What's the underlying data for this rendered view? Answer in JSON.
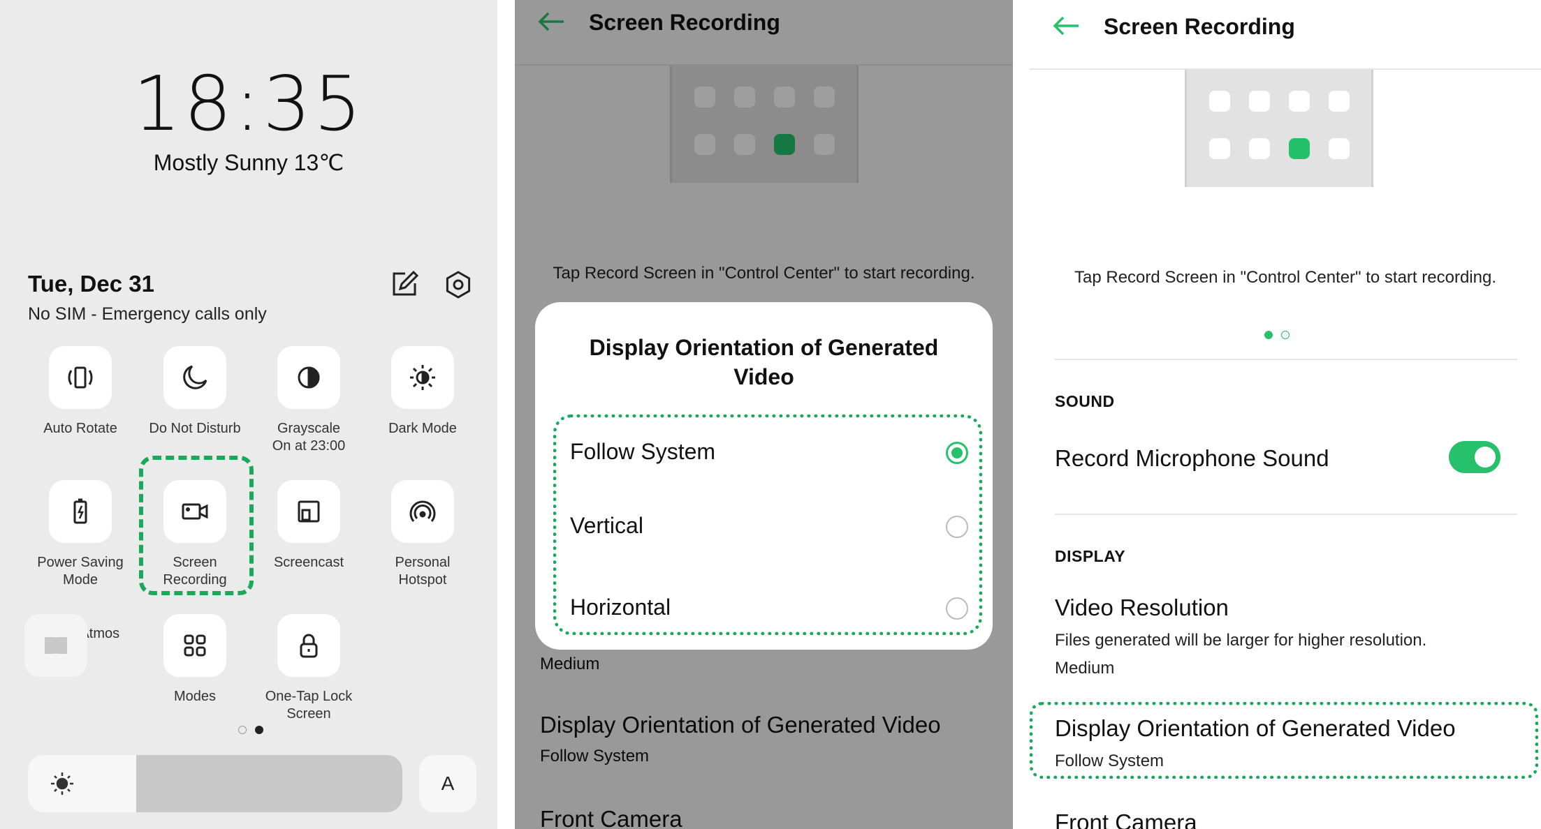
{
  "control_center": {
    "time": "18:35",
    "weather": "Mostly Sunny 13℃",
    "date": "Tue, Dec 31",
    "sim_status": "No SIM - Emergency calls only",
    "edit_icon": "edit-icon",
    "settings_icon": "settings-gear-icon",
    "tiles": [
      {
        "label": "Auto Rotate",
        "icon": "auto-rotate-icon"
      },
      {
        "label": "Do Not Disturb",
        "icon": "moon-icon"
      },
      {
        "label": "Grayscale\nOn at 23:00",
        "icon": "grayscale-icon"
      },
      {
        "label": "Dark Mode",
        "icon": "dark-mode-icon"
      },
      {
        "label": "Power Saving\nMode",
        "icon": "battery-icon"
      },
      {
        "label": "Screen\nRecording",
        "icon": "video-camera-icon"
      },
      {
        "label": "Screencast",
        "icon": "screencast-icon"
      },
      {
        "label": "Personal\nHotspot",
        "icon": "hotspot-icon"
      },
      {
        "label": "Dolby Atmos",
        "icon": "dolby-icon"
      },
      {
        "label": "Modes",
        "icon": "grid-icon"
      },
      {
        "label": "One-Tap Lock\nScreen",
        "icon": "lock-icon"
      }
    ],
    "page_indicator": {
      "pages": 2,
      "current": 2
    },
    "brightness_level": 0.29,
    "auto_brightness_label": "A"
  },
  "recording_dialog_screen": {
    "title": "Screen Recording",
    "hint": "Tap Record Screen in \"Control Center\" to start recording.",
    "dialog": {
      "title": "Display Orientation of Generated Video",
      "options": [
        {
          "label": "Follow System",
          "selected": true
        },
        {
          "label": "Vertical",
          "selected": false
        },
        {
          "label": "Horizontal",
          "selected": false
        }
      ]
    },
    "below": {
      "resolution_value": "Medium",
      "orientation_title": "Display Orientation of Generated Video",
      "orientation_value": "Follow System",
      "front_camera": "Front Camera"
    }
  },
  "recording_settings": {
    "title": "Screen Recording",
    "hint": "Tap Record Screen in \"Control Center\" to start recording.",
    "sound_section": "SOUND",
    "mic_label": "Record Microphone Sound",
    "mic_on": true,
    "display_section": "DISPLAY",
    "resolution_title": "Video Resolution",
    "resolution_desc": "Files generated will be larger for higher resolution.",
    "resolution_value": "Medium",
    "orientation_title": "Display Orientation of Generated Video",
    "orientation_value": "Follow System",
    "front_camera": "Front Camera"
  },
  "colors": {
    "accent": "#27c16d",
    "highlight": "#1aa85a"
  }
}
